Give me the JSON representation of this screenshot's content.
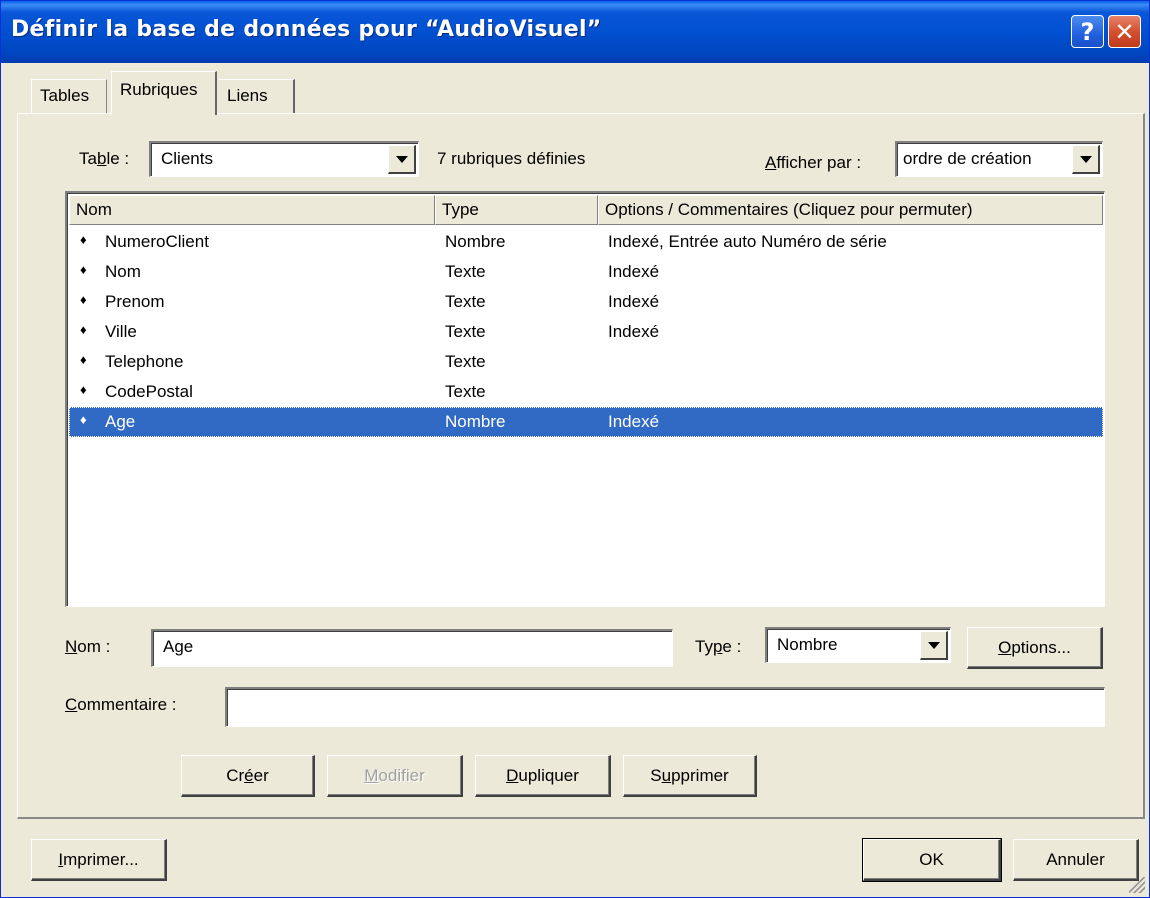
{
  "window": {
    "title": "Définir la base de données pour “AudioVisuel”",
    "help_glyph": "?",
    "close_glyph": "✕"
  },
  "tabs": [
    {
      "label": "Tables"
    },
    {
      "label": "Rubriques",
      "active": true
    },
    {
      "label": "Liens"
    }
  ],
  "table_selector": {
    "label_pre": "Ta",
    "label_accel": "b",
    "label_post": "le :",
    "value": "Clients",
    "count_text": "7 rubriques définies"
  },
  "sort_selector": {
    "label_accel": "A",
    "label_post": "fficher par :",
    "value": "ordre de création"
  },
  "list": {
    "columns": [
      "Nom",
      "Type",
      "Options / Commentaires  (Cliquez pour permuter)"
    ],
    "bullet": "♦",
    "rows": [
      {
        "name": "NumeroClient",
        "type": "Nombre",
        "options": "Indexé, Entrée auto Numéro de série"
      },
      {
        "name": "Nom",
        "type": "Texte",
        "options": "Indexé"
      },
      {
        "name": "Prenom",
        "type": "Texte",
        "options": "Indexé"
      },
      {
        "name": "Ville",
        "type": "Texte",
        "options": "Indexé"
      },
      {
        "name": "Telephone",
        "type": "Texte",
        "options": ""
      },
      {
        "name": "CodePostal",
        "type": "Texte",
        "options": ""
      },
      {
        "name": "Age",
        "type": "Nombre",
        "options": "Indexé",
        "selected": true
      }
    ]
  },
  "form": {
    "name_label_accel": "N",
    "name_label_post": "om :",
    "name_value": "Age",
    "type_label_pre": "Ty",
    "type_label_accel": "p",
    "type_label_post": "e :",
    "type_value": "Nombre",
    "options_accel": "O",
    "options_post": "ptions...",
    "comment_label_accel": "C",
    "comment_label_post": "ommentaire :",
    "comment_value": ""
  },
  "actions": {
    "create_pre": "Cr",
    "create_accel": "é",
    "create_post": "er",
    "modify_accel": "M",
    "modify_post": "odifier",
    "duplicate_accel": "D",
    "duplicate_post": "upliquer",
    "delete_pre": "S",
    "delete_accel": "u",
    "delete_post": "pprimer"
  },
  "footer": {
    "print_accel": "I",
    "print_post": "mprimer...",
    "ok_label": "OK",
    "cancel_label": "Annuler"
  }
}
